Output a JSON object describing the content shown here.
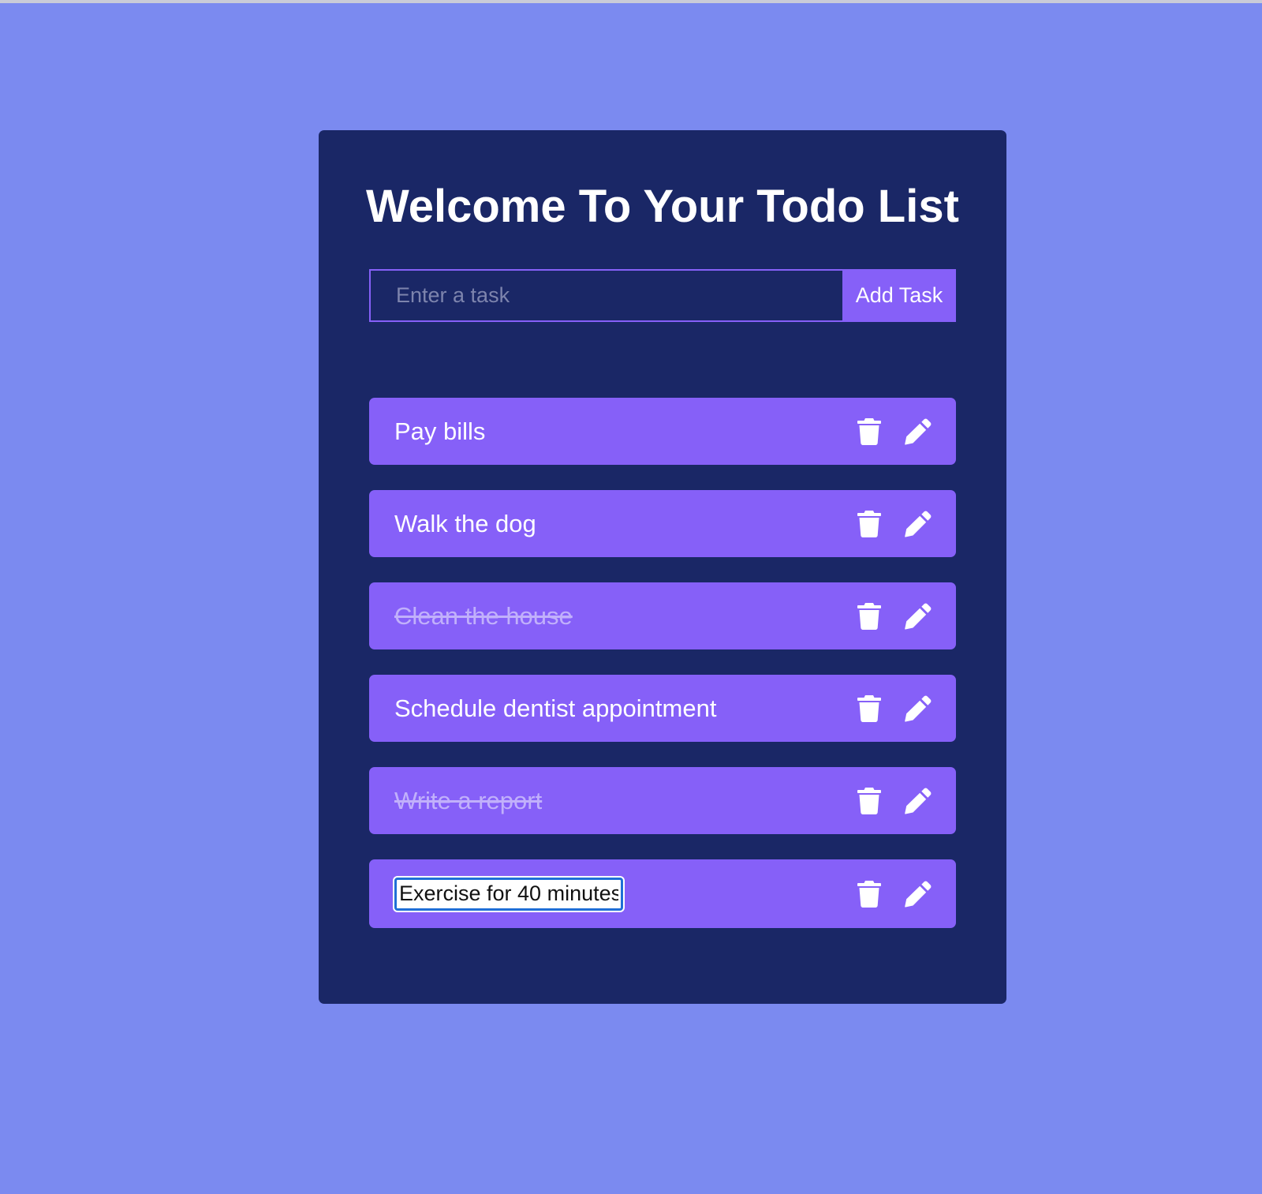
{
  "page": {
    "title": "Welcome To Your Todo List"
  },
  "form": {
    "input_value": "",
    "input_placeholder": "Enter a task",
    "add_button_label": "Add Task"
  },
  "todos": [
    {
      "text": "Pay bills",
      "completed": false,
      "editing": false
    },
    {
      "text": "Walk the dog",
      "completed": false,
      "editing": false
    },
    {
      "text": "Clean the house",
      "completed": true,
      "editing": false
    },
    {
      "text": "Schedule dentist appointment",
      "completed": false,
      "editing": false
    },
    {
      "text": "Write a report",
      "completed": true,
      "editing": false
    },
    {
      "text": "Exercise for 40 minutes",
      "completed": false,
      "editing": true
    }
  ],
  "icons": {
    "delete": "trash-icon",
    "edit": "pencil-icon"
  },
  "colors": {
    "background": "#7b8af0",
    "card": "#1a2766",
    "accent": "#8660f8",
    "text": "#ffffff",
    "completed_text": "#c1b0fb"
  }
}
